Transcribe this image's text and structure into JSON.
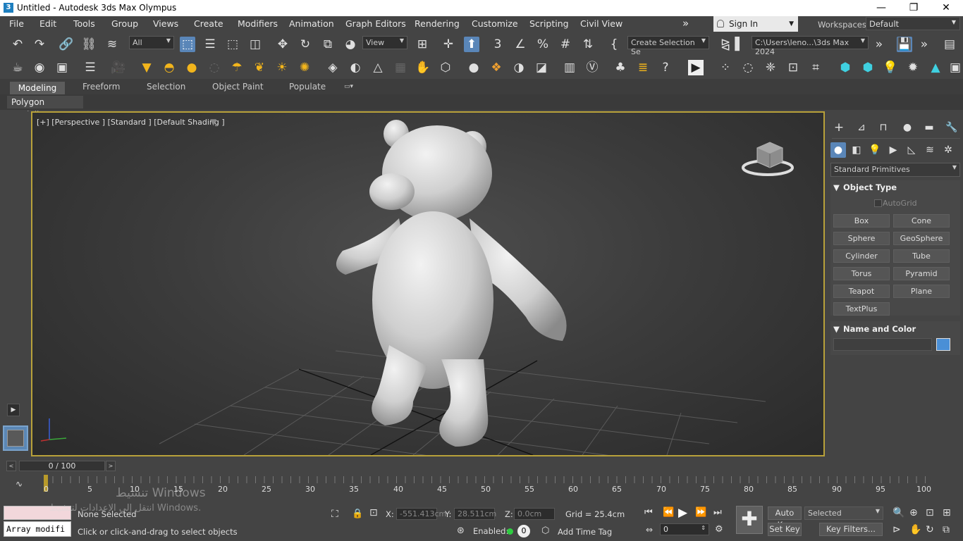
{
  "window": {
    "title": "Untitled - Autodesk 3ds Max Olympus",
    "app_icon": "3",
    "minimize": "—",
    "restore": "❐",
    "close": "✕"
  },
  "menu": {
    "items": [
      "File",
      "Edit",
      "Tools",
      "Group",
      "Views",
      "Create",
      "Modifiers",
      "Animation",
      "Graph Editors",
      "Rendering",
      "Customize",
      "Scripting",
      "Civil View"
    ],
    "overflow": "»",
    "sign_in": "Sign In",
    "workspaces_label": "Workspaces:",
    "workspace_value": "Default"
  },
  "toolbar1": {
    "filter_dropdown": "All",
    "refcoord_dropdown": "View",
    "selection_set": "Create Selection Se",
    "project_path": "C:\\Users\\leno...\\3ds Max 2024"
  },
  "ribbon": {
    "tabs": [
      "Modeling",
      "Freeform",
      "Selection",
      "Object Paint",
      "Populate"
    ],
    "active_panel": "Polygon Modeling"
  },
  "viewport": {
    "label": "[+] [Perspective ] [Standard ] [Default Shading ]"
  },
  "command_panel": {
    "category_dropdown": "Standard Primitives",
    "object_type_header": "Object Type",
    "autogrid": "AutoGrid",
    "buttons": [
      "Box",
      "Cone",
      "Sphere",
      "GeoSphere",
      "Cylinder",
      "Tube",
      "Torus",
      "Pyramid",
      "Teapot",
      "Plane",
      "TextPlus"
    ],
    "name_color_header": "Name and Color",
    "swatch_color": "#4a8fd6"
  },
  "timeline": {
    "slider_value": "0 / 100",
    "ticks": [
      "0",
      "5",
      "10",
      "15",
      "20",
      "25",
      "30",
      "35",
      "40",
      "45",
      "50",
      "55",
      "60",
      "65",
      "70",
      "75",
      "80",
      "85",
      "90",
      "95",
      "100"
    ]
  },
  "status": {
    "maxscript_text": "Array modifi",
    "selection": "None Selected",
    "prompt": "Click or click-and-drag to select objects",
    "x_label": "X:",
    "x_value": "-551.413cm",
    "y_label": "Y:",
    "y_value": "28.511cm",
    "z_label": "Z:",
    "z_value": "0.0cm",
    "grid": "Grid = 25.4cm",
    "enabled_label": "Enabled:",
    "enabled_value": "0",
    "add_time_tag": "Add Time Tag",
    "auto_key": "Auto Key",
    "set_key": "Set Key",
    "key_mode": "Selected",
    "key_filters": "Key Filters...",
    "frame_value": "0"
  },
  "watermark": {
    "line1": "تنشيط Windows",
    "line2": "انتقل إلى الإعدادات لتنشيط Windows."
  }
}
